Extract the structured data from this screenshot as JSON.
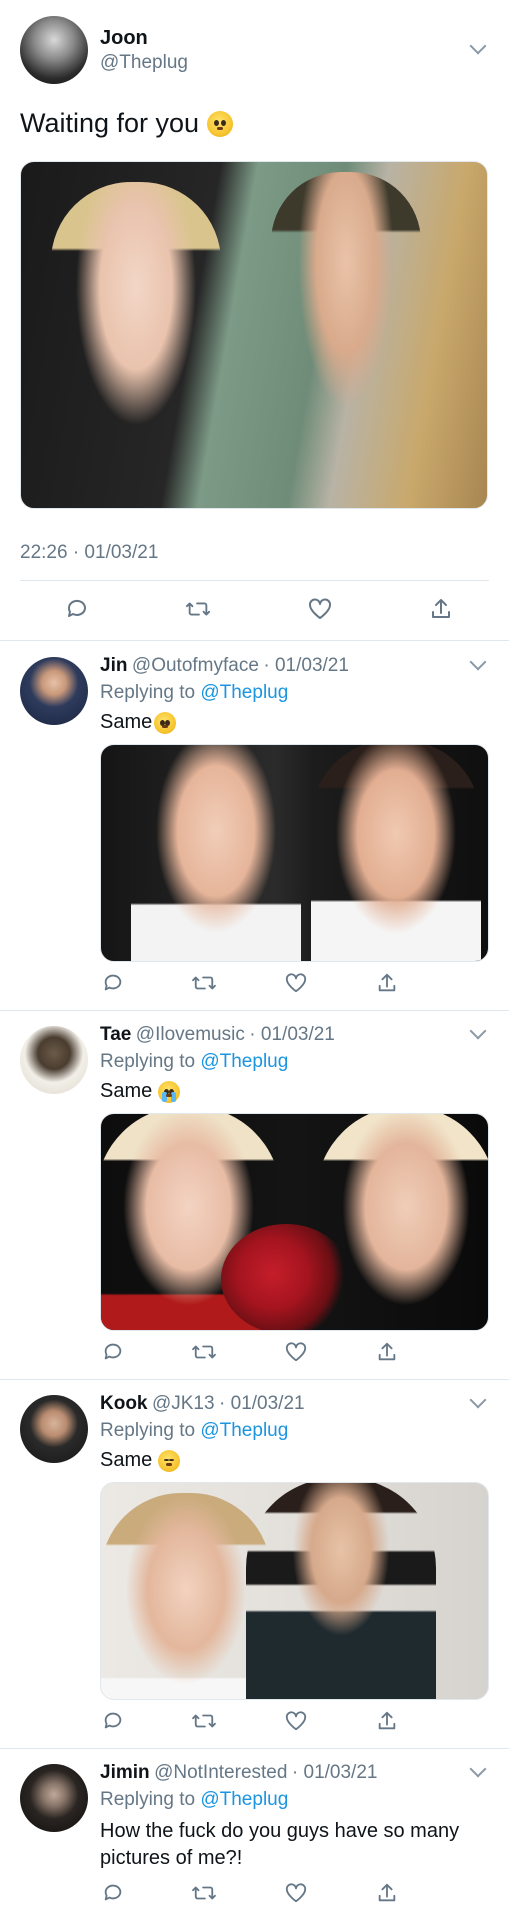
{
  "main_tweet": {
    "name": "Joon",
    "handle": "@Theplug",
    "text": "Waiting for you",
    "emoji": "pleading-face",
    "timestamp": "22:26 · 01/03/21"
  },
  "replies": [
    {
      "name": "Jin",
      "handle": "@Outofmyface",
      "dot_date": "· 01/03/21",
      "replying_prefix": "Replying to",
      "replying_to": "@Theplug",
      "text": "Same",
      "emoji": "pleading-face"
    },
    {
      "name": "Tae",
      "handle": "@Ilovemusic",
      "dot_date": "· 01/03/21",
      "replying_prefix": "Replying to",
      "replying_to": "@Theplug",
      "text": "Same",
      "emoji": "loudly-crying-face"
    },
    {
      "name": "Kook",
      "handle": "@JK13",
      "dot_date": "· 01/03/21",
      "replying_prefix": "Replying to",
      "replying_to": "@Theplug",
      "text": "Same",
      "emoji": "pensive-face"
    },
    {
      "name": "Jimin",
      "handle": "@NotInterested",
      "dot_date": "· 01/03/21",
      "replying_prefix": "Replying to",
      "replying_to": "@Theplug",
      "text_line1": "How the fuck do you guys have so many",
      "text_line2": "pictures of me?!"
    }
  ],
  "icons": [
    "reply-icon",
    "retweet-icon",
    "like-icon",
    "share-icon",
    "chevron-down-icon"
  ],
  "colors": {
    "link": "#1b95e0",
    "muted": "#657786",
    "divider": "#e1e8ed"
  }
}
